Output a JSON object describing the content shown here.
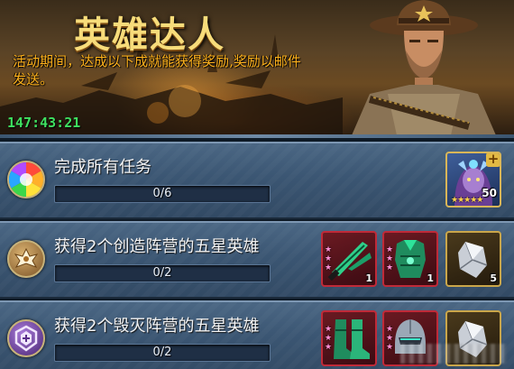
{
  "banner": {
    "title": "英雄达人",
    "description": "活动期间，达成以下成就能获得奖励,奖励以邮件发送。",
    "timer": "147:43:21"
  },
  "tasks": [
    {
      "icon": "color-wheel-icon",
      "label": "完成所有任务",
      "progress_text": "0/6",
      "progress_fraction": 0,
      "rewards": [
        {
          "type": "hero-portrait",
          "level": "50",
          "stars": "★★★★★",
          "plus": "+"
        }
      ]
    },
    {
      "icon": "creation-faction-emblem-icon",
      "label": "获得2个创造阵营的五星英雄",
      "progress_text": "0/2",
      "progress_fraction": 0,
      "rewards": [
        {
          "type": "weapon-shard",
          "count": "1",
          "stars": [
            "★",
            "★",
            "★"
          ]
        },
        {
          "type": "armor-shard",
          "count": "1",
          "stars": [
            "★",
            "★",
            "★"
          ]
        },
        {
          "type": "crystal-shard",
          "count": "5"
        }
      ]
    },
    {
      "icon": "destruction-faction-emblem-icon",
      "label": "获得2个毁灭阵营的五星英雄",
      "progress_text": "0/2",
      "progress_fraction": 0,
      "rewards": [
        {
          "type": "boots-shard",
          "stars": [
            "★",
            "★",
            "★"
          ]
        },
        {
          "type": "helmet-shard",
          "stars": [
            "★",
            "★",
            "★"
          ]
        },
        {
          "type": "crystal-shard"
        }
      ]
    }
  ],
  "colors": {
    "title": "#f7dc7a",
    "description": "#ffb21c",
    "timer": "#3ee060",
    "rare_frame": "#c02a38",
    "gold_frame": "#caa64a"
  }
}
